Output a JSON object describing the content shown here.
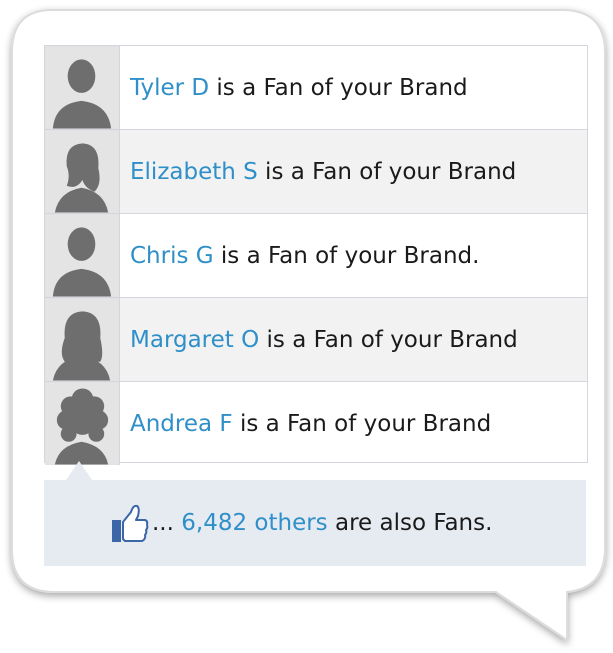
{
  "fans": [
    {
      "name": "Tyler D",
      "suffix": " is a Fan of your Brand",
      "avatar": "male-avatar-icon"
    },
    {
      "name": "Elizabeth S",
      "suffix": " is a Fan of your Brand",
      "avatar": "female-avatar-icon"
    },
    {
      "name": "Chris G",
      "suffix": " is a Fan of your Brand.",
      "avatar": "male-avatar-icon"
    },
    {
      "name": "Margaret O",
      "suffix": " is a Fan of your Brand",
      "avatar": "female-avatar-icon"
    },
    {
      "name": "Andrea F",
      "suffix": " is a Fan of your Brand",
      "avatar": "curly-female-avatar-icon"
    }
  ],
  "footer": {
    "prefix": "... ",
    "count": "6,482 others",
    "suffix": " are also Fans.",
    "icon": "thumbs-up-icon"
  },
  "colors": {
    "link": "#2f8fc8",
    "text": "#1a1a1a",
    "footer_bg": "#e6ebf2",
    "row_alt_bg": "#f2f2f2",
    "border": "#d3d6dc"
  }
}
